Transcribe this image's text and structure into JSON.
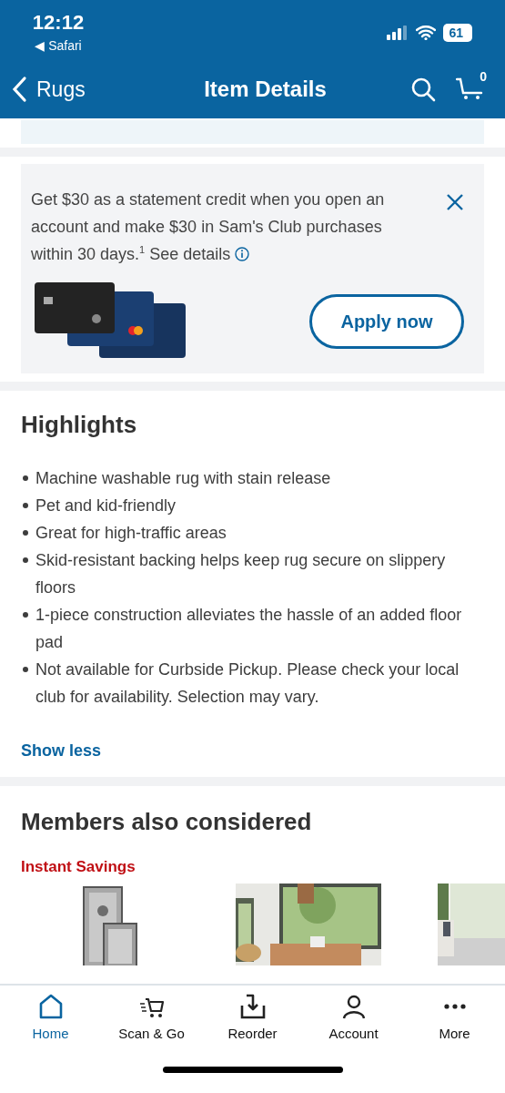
{
  "status_bar": {
    "time": "12:12",
    "back_app": "◀ Safari",
    "battery": "61"
  },
  "nav": {
    "back_label": "Rugs",
    "title": "Item Details",
    "cart_count": "0"
  },
  "promo": {
    "text": "Get $30 as a statement credit when you open an account and make $30 in Sam's Club purchases within 30 days.$^{1}$",
    "link": "See details",
    "button": "Apply now"
  },
  "highlights": {
    "title": "Highlights",
    "items": [
      "Machine washable rug with stain release",
      "Pet and kid-friendly",
      "Great for high-traffic areas",
      "Skid-resistant backing helps keep rug secure on slippery floors",
      "1-piece construction alleviates the hassle of an added floor pad",
      "Not available for Curbside Pickup. Please check your local club for availability. Selection may vary."
    ],
    "toggle": "Show less"
  },
  "members": {
    "title": "Members also considered",
    "badge": "Instant Savings"
  },
  "tab_bar": [
    {
      "label": "Home",
      "selected": true
    },
    {
      "label": "Scan & Go",
      "selected": false
    },
    {
      "label": "Reorder",
      "selected": false
    },
    {
      "label": "Account",
      "selected": false
    },
    {
      "label": "More",
      "selected": false
    }
  ]
}
